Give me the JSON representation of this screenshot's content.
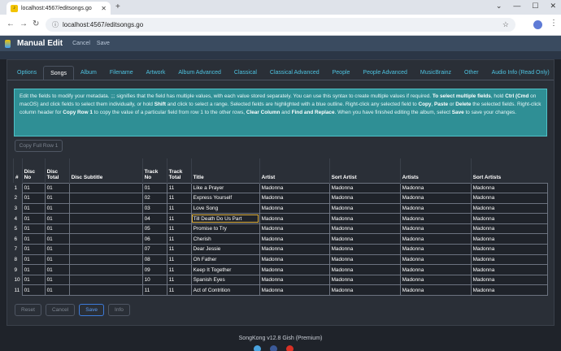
{
  "browser": {
    "tab_title": "localhost:4567/editsongs.go",
    "tab_close": "✕",
    "new_tab": "+",
    "url": "localhost:4567/editsongs.go",
    "win_min": "—",
    "win_max": "☐",
    "win_close": "✕",
    "tab_list": "⌄"
  },
  "app": {
    "title": "Manual Edit",
    "cancel": "Cancel",
    "save": "Save"
  },
  "tabs": [
    "Options",
    "Songs",
    "Album",
    "Filename",
    "Artwork",
    "Album Advanced",
    "Classical",
    "Classical Advanced",
    "People",
    "People Advanced",
    "MusicBrainz",
    "Other",
    "Audio Info (Read Only)"
  ],
  "active_tab": "Songs",
  "copy_full_row": "Copy Full Row 1",
  "columns": [
    "#",
    "Disc No",
    "Disc Total",
    "Disc Subtitle",
    "Track No",
    "Track Total",
    "Title",
    "Artist",
    "Sort Artist",
    "Artists",
    "Sort Artists"
  ],
  "rows": [
    [
      "1",
      "01",
      "01",
      "",
      "01",
      "11",
      "Like a Prayer",
      "Madonna",
      "Madonna",
      "Madonna",
      "Madonna"
    ],
    [
      "2",
      "01",
      "01",
      "",
      "02",
      "11",
      "Express Yourself",
      "Madonna",
      "Madonna",
      "Madonna",
      "Madonna"
    ],
    [
      "3",
      "01",
      "01",
      "",
      "03",
      "11",
      "Love Song",
      "Madonna",
      "Madonna",
      "Madonna",
      "Madonna"
    ],
    [
      "4",
      "01",
      "01",
      "",
      "04",
      "11",
      "Till Death Do Us Part",
      "Madonna",
      "Madonna",
      "Madonna",
      "Madonna"
    ],
    [
      "5",
      "01",
      "01",
      "",
      "05",
      "11",
      "Promise to Try",
      "Madonna",
      "Madonna",
      "Madonna",
      "Madonna"
    ],
    [
      "6",
      "01",
      "01",
      "",
      "06",
      "11",
      "Cherish",
      "Madonna",
      "Madonna",
      "Madonna",
      "Madonna"
    ],
    [
      "7",
      "01",
      "01",
      "",
      "07",
      "11",
      "Dear Jessie",
      "Madonna",
      "Madonna",
      "Madonna",
      "Madonna"
    ],
    [
      "8",
      "01",
      "01",
      "",
      "08",
      "11",
      "Oh Father",
      "Madonna",
      "Madonna",
      "Madonna",
      "Madonna"
    ],
    [
      "9",
      "01",
      "01",
      "",
      "09",
      "11",
      "Keep It Together",
      "Madonna",
      "Madonna",
      "Madonna",
      "Madonna"
    ],
    [
      "10",
      "01",
      "01",
      "",
      "10",
      "11",
      "Spanish Eyes",
      "Madonna",
      "Madonna",
      "Madonna",
      "Madonna"
    ],
    [
      "11",
      "01",
      "01",
      "",
      "11",
      "11",
      "Act of Contrition",
      "Madonna",
      "Madonna",
      "Madonna",
      "Madonna"
    ]
  ],
  "selected_row": 4,
  "buttons": {
    "reset": "Reset",
    "cancel": "Cancel",
    "save": "Save",
    "info": "Info"
  },
  "footer": "SongKong v12.8 Gish (Premium)"
}
